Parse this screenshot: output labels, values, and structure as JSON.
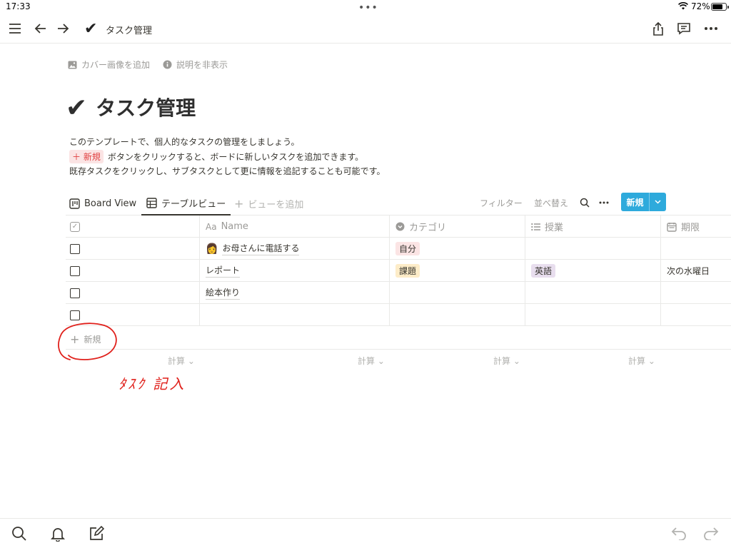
{
  "status": {
    "time": "17:33",
    "battery": "72%"
  },
  "topbar": {
    "crumb_title": "タスク管理"
  },
  "header_links": {
    "add_cover": "カバー画像を追加",
    "hide_description": "説明を非表示"
  },
  "page": {
    "title": "タスク管理",
    "description": {
      "line1": "このテンプレートで、個人的なタスクの管理をしましょう。",
      "chip": "＋ 新規",
      "line2_rest": "ボタンをクリックすると、ボードに新しいタスクを追加できます。",
      "line3": "既存タスクをクリックし、サブタスクとして更に情報を追記することも可能です。"
    }
  },
  "views": {
    "board": "Board View",
    "table": "テーブルビュー",
    "add": "ビューを追加",
    "filter": "フィルター",
    "sort": "並べ替え",
    "new": "新規"
  },
  "table": {
    "columns": [
      "Name",
      "カテゴリ",
      "授業",
      "期限"
    ],
    "rows": [
      {
        "emoji": "👩",
        "name": "お母さんに電話する",
        "category": "自分",
        "class": "",
        "due": ""
      },
      {
        "emoji": "",
        "name": "レポート",
        "category": "課題",
        "class": "英語",
        "due": "次の水曜日"
      },
      {
        "emoji": "",
        "name": "絵本作り",
        "category": "",
        "class": "",
        "due": ""
      },
      {
        "emoji": "",
        "name": "",
        "category": "",
        "class": "",
        "due": ""
      }
    ],
    "new_row": "新規",
    "calc": "計算"
  },
  "annotation": {
    "text": "ﾀｽｸ 記入"
  },
  "colors": {
    "accent": "#2eaadc",
    "tag_self_bg": "#fbe4e4",
    "tag_assignment_bg": "#fdecc8",
    "tag_english_bg": "#e8deee",
    "annotation": "#e0201b"
  }
}
